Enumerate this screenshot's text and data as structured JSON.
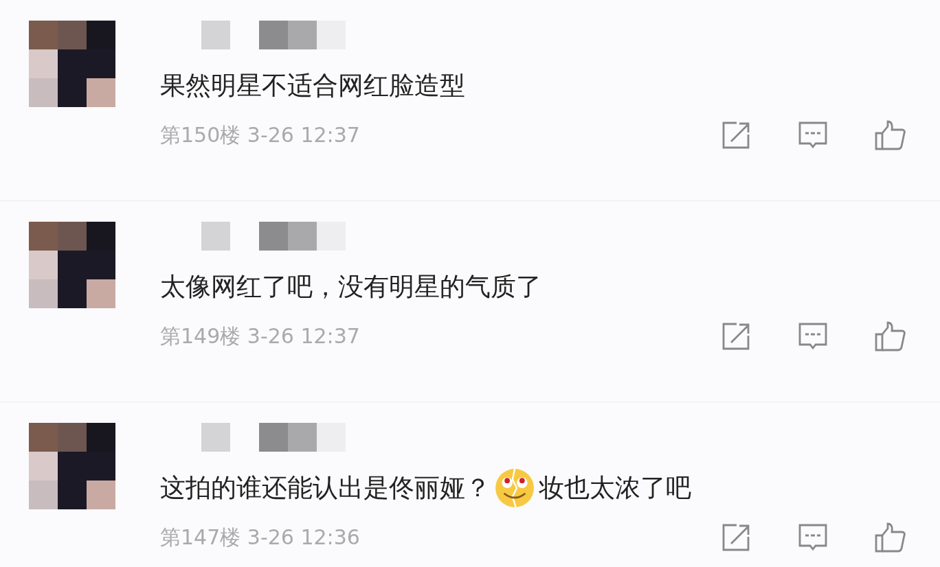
{
  "comments": [
    {
      "segments": [
        {
          "kind": "text",
          "text": "果然明星不适合网红脸造型"
        }
      ],
      "meta": "第150楼 3-26 12:37"
    },
    {
      "segments": [
        {
          "kind": "text",
          "text": "太像网红了吧，没有明星的气质了"
        }
      ],
      "meta": "第149楼 3-26 12:37"
    },
    {
      "segments": [
        {
          "kind": "text",
          "text": "这拍的谁还能认出是佟丽娅？"
        },
        {
          "kind": "emoji"
        },
        {
          "kind": "text",
          "text": "妆也太浓了吧"
        }
      ],
      "meta": "第147楼 3-26 12:36"
    }
  ]
}
